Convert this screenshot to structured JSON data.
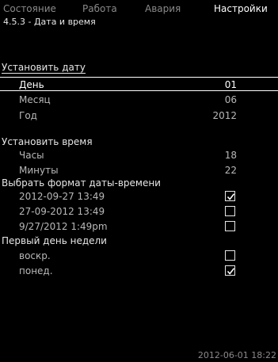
{
  "tabs": [
    "Состояние",
    "Работа",
    "Авария",
    "Настройки"
  ],
  "path": "4.5.3 - Дата и время",
  "set_date": {
    "title": "Установить дату",
    "rows": [
      {
        "label": "День",
        "value": "01"
      },
      {
        "label": "Месяц",
        "value": "06"
      },
      {
        "label": "Год",
        "value": "2012"
      }
    ]
  },
  "set_time": {
    "title": "Установить время",
    "rows": [
      {
        "label": "Часы",
        "value": "18"
      },
      {
        "label": "Минуты",
        "value": "22"
      }
    ]
  },
  "format": {
    "title": "Выбрать формат даты-времени",
    "options": [
      {
        "label": "2012-09-27  13:49",
        "checked": true
      },
      {
        "label": "27-09-2012  13:49",
        "checked": false
      },
      {
        "label": "9/27/2012  1:49pm",
        "checked": false
      }
    ]
  },
  "first_day": {
    "title": "Первый день недели",
    "options": [
      {
        "label": "воскр.",
        "checked": false
      },
      {
        "label": "понед.",
        "checked": true
      }
    ]
  },
  "footer": "2012-06-01  18:22"
}
